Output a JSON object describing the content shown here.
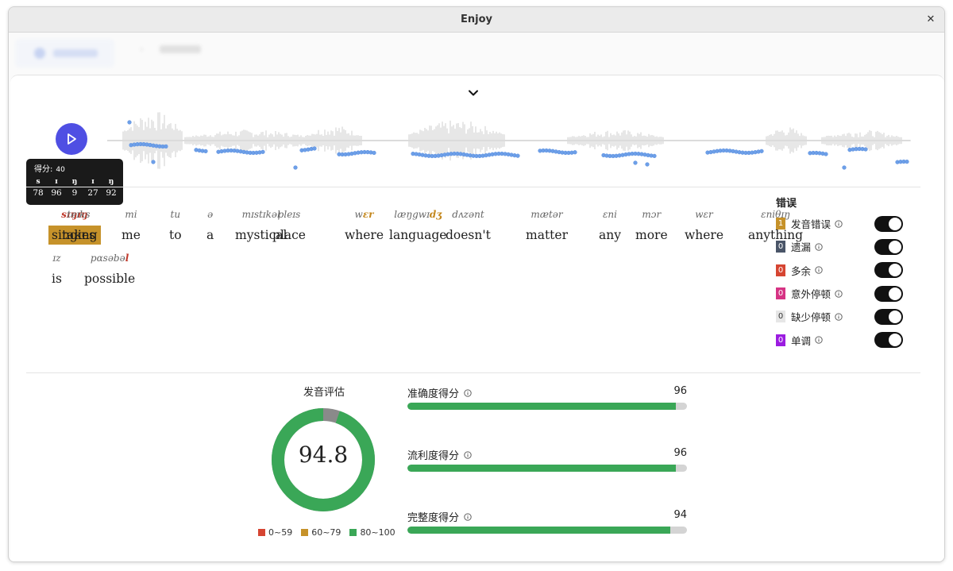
{
  "window": {
    "title": "Enjoy",
    "close_glyph": "✕"
  },
  "tooltip": {
    "score_label": "得分:",
    "score_value": "40",
    "phonemes": [
      {
        "ph": "s",
        "score": "78"
      },
      {
        "ph": "ɪ",
        "score": "96"
      },
      {
        "ph": "ŋ",
        "score": "9"
      },
      {
        "ph": "ɪ",
        "score": "27"
      },
      {
        "ph": "ŋ",
        "score": "92"
      }
    ]
  },
  "words": [
    {
      "text": "singing",
      "ipa": "sɪŋɪŋ",
      "highlight": true
    },
    {
      "text": "takes",
      "ipa": "teɪks"
    },
    {
      "text": "me",
      "ipa": "mi"
    },
    {
      "text": "to",
      "ipa": "tu"
    },
    {
      "text": "a",
      "ipa": "ə"
    },
    {
      "text": "mystical",
      "ipa": "mɪstɪkəl"
    },
    {
      "text": "place",
      "ipa": "pleɪs"
    },
    {
      "text": "where",
      "ipa": "wɛr"
    },
    {
      "text": "language",
      "ipa": "læŋgwɪdʒ"
    },
    {
      "text": "doesn't",
      "ipa": "dʌzənt"
    },
    {
      "text": "matter",
      "ipa": "mætər"
    },
    {
      "text": "any",
      "ipa": "ɛni"
    },
    {
      "text": "more",
      "ipa": "mɔr"
    },
    {
      "text": "where",
      "ipa": "wɛr"
    },
    {
      "text": "anything",
      "ipa": "ɛniθɪŋ"
    },
    {
      "text": "is",
      "ipa": "ɪz"
    },
    {
      "text": "possible",
      "ipa": "pɑsəbəl"
    }
  ],
  "errors_legend": {
    "title": "错误",
    "items": [
      {
        "count": "1",
        "label": "发音错误",
        "color": "#c6922a",
        "enabled": true
      },
      {
        "count": "0",
        "label": "遗漏",
        "color": "#4a5568",
        "enabled": true
      },
      {
        "count": "0",
        "label": "多余",
        "color": "#d64532",
        "enabled": true
      },
      {
        "count": "0",
        "label": "意外停顿",
        "color": "#d63384",
        "enabled": true
      },
      {
        "count": "0",
        "label": "缺少停顿",
        "color": "#e6e6e6",
        "enabled": true
      },
      {
        "count": "0",
        "label": "单调",
        "color": "#9b1ce0",
        "enabled": true
      }
    ]
  },
  "evaluation": {
    "title": "发音评估",
    "overall": "94.8",
    "overall_value": 94.8,
    "ranges": [
      {
        "label": "0~59",
        "color": "#d64532"
      },
      {
        "label": "60~79",
        "color": "#c6922a"
      },
      {
        "label": "80~100",
        "color": "#3aa757"
      }
    ],
    "metrics": [
      {
        "label": "准确度得分",
        "value": "96",
        "percent": 96
      },
      {
        "label": "流利度得分",
        "value": "96",
        "percent": 96
      },
      {
        "label": "完整度得分",
        "value": "94",
        "percent": 94
      }
    ]
  },
  "colors": {
    "accent": "#4f4fe3",
    "pitch": "#6d9fe8",
    "good": "#3aa757",
    "mispronounced": "#c6922a"
  },
  "icons": {
    "play": "play-icon",
    "collapse": "chevron-down-icon",
    "info": "info-circle-icon",
    "close": "close-icon"
  }
}
